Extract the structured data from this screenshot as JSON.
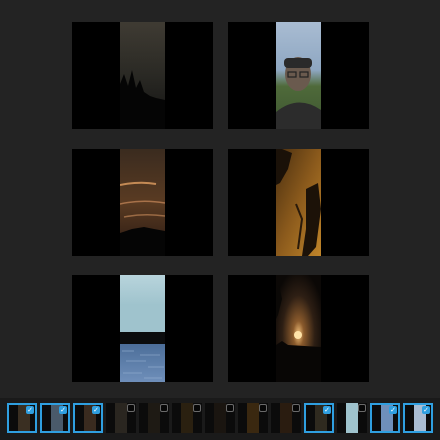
{
  "gallery": {
    "photos": [
      {
        "name": "trees-dusk"
      },
      {
        "name": "person-selfie"
      },
      {
        "name": "sunset-clouds"
      },
      {
        "name": "shadow-wall"
      },
      {
        "name": "sky-water"
      },
      {
        "name": "sunset-sun"
      }
    ]
  },
  "filmstrip": {
    "thumbnails": [
      {
        "selected": true
      },
      {
        "selected": true
      },
      {
        "selected": true
      },
      {
        "selected": false
      },
      {
        "selected": false
      },
      {
        "selected": false
      },
      {
        "selected": false
      },
      {
        "selected": false
      },
      {
        "selected": false
      },
      {
        "selected": true
      },
      {
        "selected": false
      },
      {
        "selected": true
      },
      {
        "selected": true
      }
    ],
    "check_glyph": "✓"
  },
  "colors": {
    "background": "#232323",
    "selection_accent": "#2f9fe0",
    "tile_letterbox": "#000000"
  }
}
